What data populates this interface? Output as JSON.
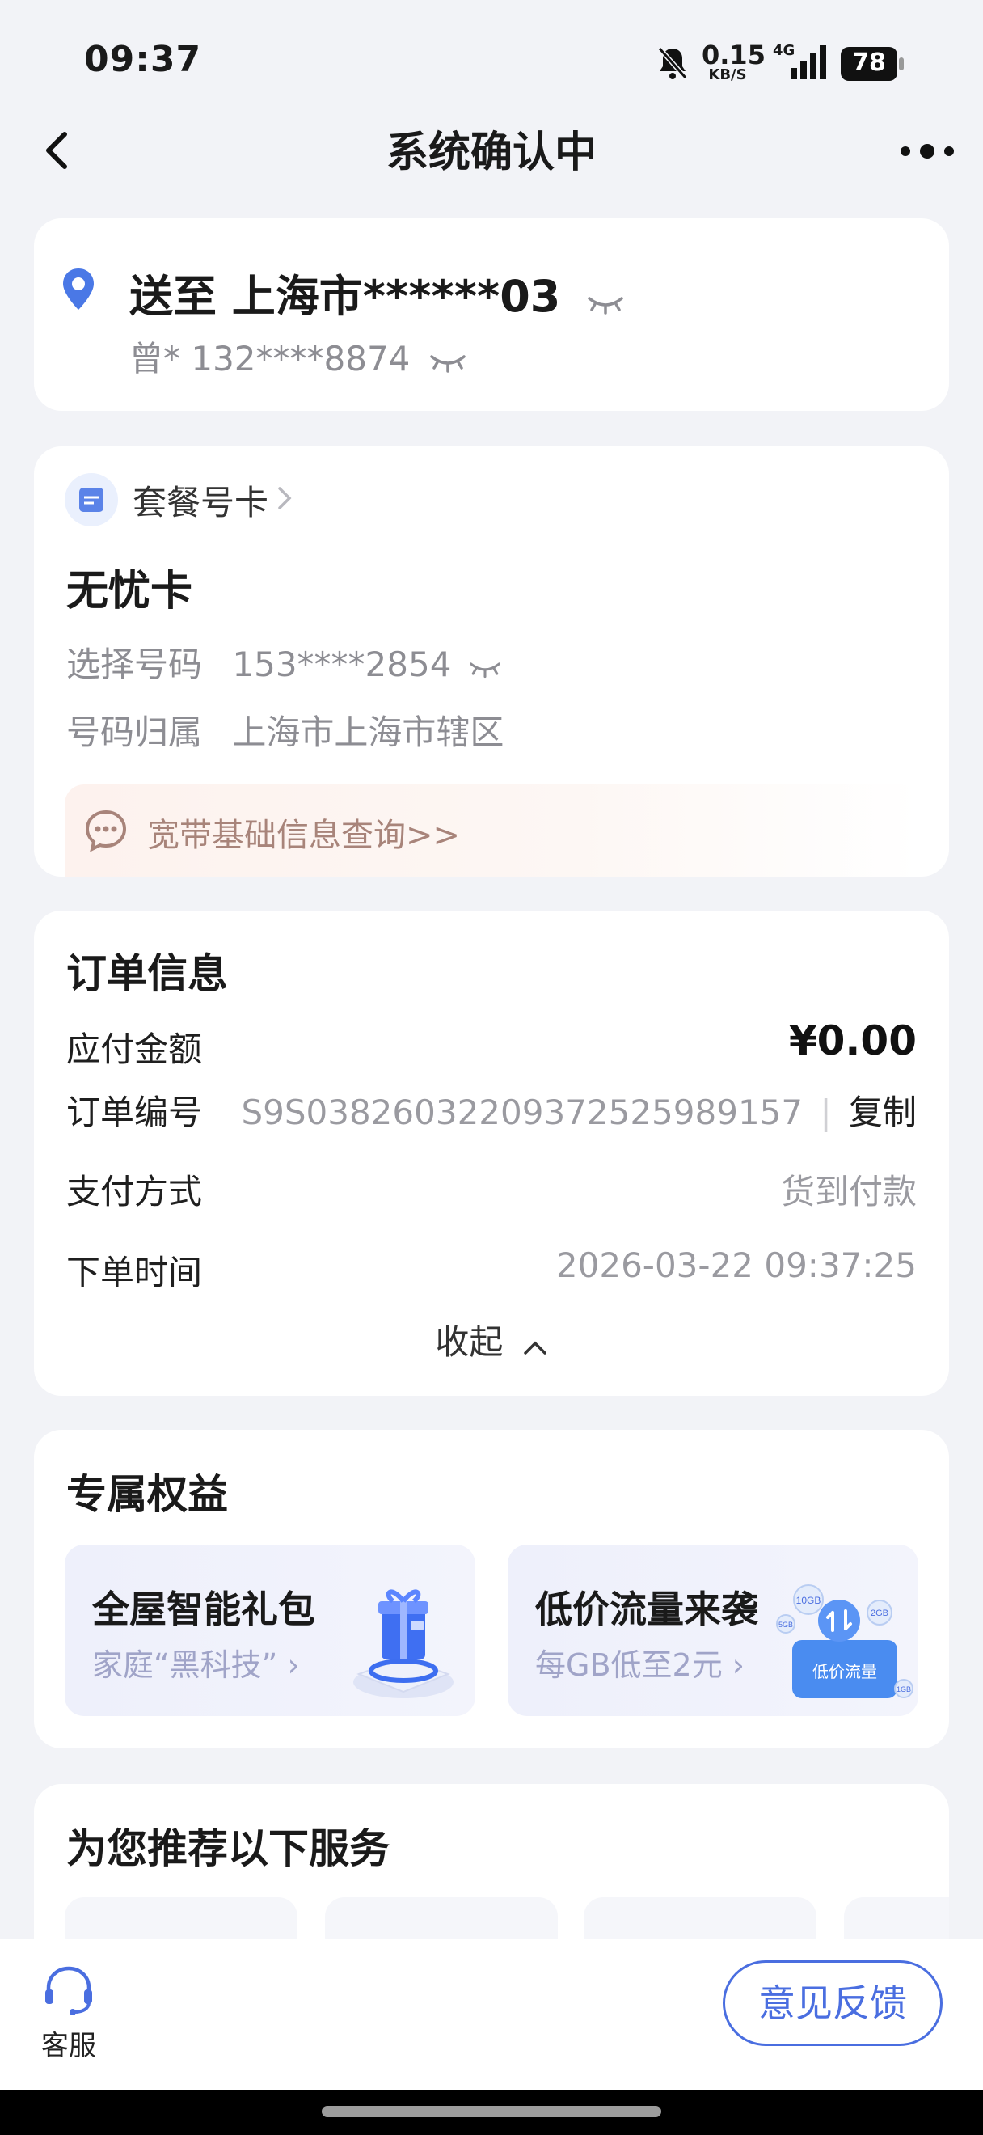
{
  "status_bar": {
    "time": "09:37",
    "net_speed_value": "0.15",
    "net_speed_unit": "KB/S",
    "network": "4G",
    "battery": "78"
  },
  "nav": {
    "title": "系统确认中"
  },
  "address": {
    "line": "送至 上海市******03",
    "contact": "曾* 132****8874"
  },
  "plan": {
    "category": "套餐号卡",
    "name": "无忧卡",
    "number_label": "选择号码",
    "number_value": "153****2854",
    "region_label": "号码归属",
    "region_value": "上海市上海市辖区",
    "broadband_link": "宽带基础信息查询>>"
  },
  "order": {
    "heading": "订单信息",
    "amount_label": "应付金额",
    "amount_value": "¥0.00",
    "order_no_label": "订单编号",
    "order_no_value": "S9S038260322093725259891​57",
    "copy_label": "复制",
    "pay_label": "支付方式",
    "pay_value": "货到付款",
    "time_label": "下单时间",
    "time_value": "2026-03-22 09:37:25",
    "collapse_label": "收起"
  },
  "benefits": {
    "heading": "专属权益",
    "items": [
      {
        "title": "全屋智能礼包",
        "subtitle": "家庭“黑科技”"
      },
      {
        "title": "低价流量来袭",
        "subtitle": "每GB低至2元"
      }
    ],
    "badge_text": "低价流量",
    "bubble_labels": [
      "10GB",
      "2GB",
      "5GB",
      "1GB"
    ]
  },
  "recommend": {
    "heading": "为您推荐以下服务"
  },
  "bottom_bar": {
    "service_label": "客服",
    "feedback_label": "意见反馈"
  },
  "colors": {
    "accent": "#4a6ee0",
    "page_bg": "#f2f3f7",
    "link_brown": "#a8847a"
  }
}
